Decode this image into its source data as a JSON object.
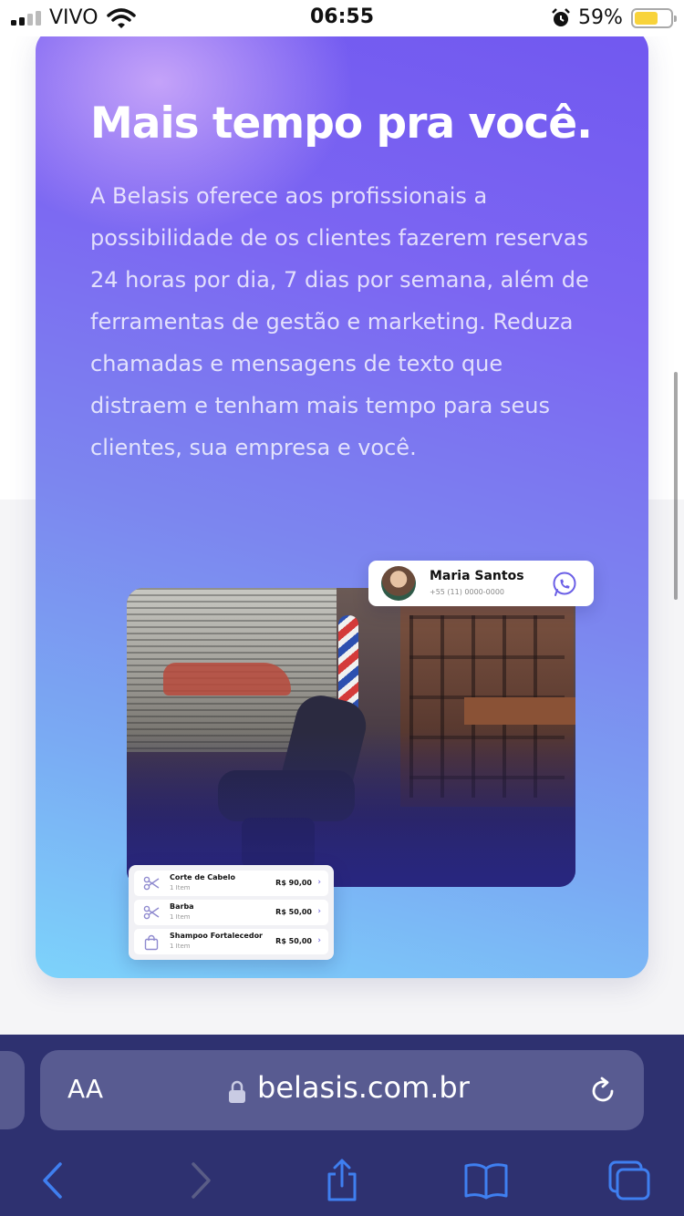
{
  "status_bar": {
    "carrier": "VIVO",
    "time": "06:55",
    "battery": "59%"
  },
  "hero": {
    "title": "Mais tempo pra você.",
    "body": "A Belasis oferece aos profissionais a possibilidade de os clientes fazerem reservas 24 horas por dia, 7 dias por semana, além de ferramentas de gestão e marketing. Reduza chamadas e mensagens de texto que distraem e tenham mais tempo para seus clientes, sua empresa e você."
  },
  "contact": {
    "name": "Maria Santos",
    "phone": "+55 (11) 0000-0000"
  },
  "services": [
    {
      "name": "Corte de Cabelo",
      "qty": "1 Item",
      "price": "R$ 90,00",
      "icon": "scissors-icon"
    },
    {
      "name": "Barba",
      "qty": "1 Item",
      "price": "R$ 50,00",
      "icon": "scissors-icon"
    },
    {
      "name": "Shampoo Fortalecedor",
      "qty": "1 Item",
      "price": "R$ 50,00",
      "icon": "shopping-bag-icon"
    }
  ],
  "browser": {
    "text_size_label": "AA",
    "url": "belasis.com.br"
  },
  "colors": {
    "accent": "#7158f0",
    "browser_bg": "#2e3170",
    "icon_blue": "#3f7ff0"
  }
}
